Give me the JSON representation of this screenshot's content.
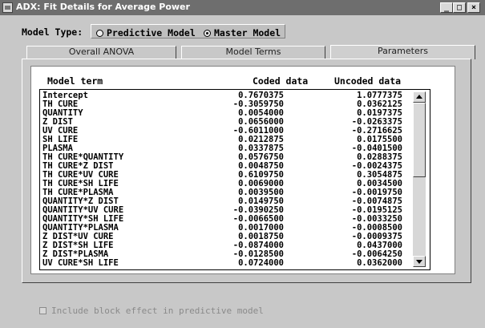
{
  "window": {
    "title": "ADX: Fit Details for Average Power",
    "buttons": {
      "minimize": "_",
      "maximize": "□",
      "close": "×"
    }
  },
  "model_type": {
    "label": "Model Type:",
    "options": [
      {
        "label": "Predictive Model",
        "selected": false
      },
      {
        "label": "Master Model",
        "selected": true
      }
    ]
  },
  "tabs": [
    {
      "label": "Overall ANOVA",
      "active": false
    },
    {
      "label": "Model Terms",
      "active": false
    },
    {
      "label": "Parameters",
      "active": true
    }
  ],
  "table": {
    "headers": [
      "Model term",
      "Coded data",
      "Uncoded data"
    ],
    "rows": [
      [
        "Intercept",
        "0.7670375",
        "1.0777375"
      ],
      [
        "TH CURE",
        "-0.3059750",
        "0.0362125"
      ],
      [
        "QUANTITY",
        "0.0054000",
        "0.0197375"
      ],
      [
        "Z DIST",
        "0.0656000",
        "-0.0263375"
      ],
      [
        "UV CURE",
        "-0.6011000",
        "-0.2716625"
      ],
      [
        "SH LIFE",
        "0.0212875",
        "0.0175500"
      ],
      [
        "PLASMA",
        "0.0337875",
        "-0.0401500"
      ],
      [
        "TH CURE*QUANTITY",
        "0.0576750",
        "0.0288375"
      ],
      [
        "TH CURE*Z DIST",
        "0.0048750",
        "-0.0024375"
      ],
      [
        "TH CURE*UV CURE",
        "0.6109750",
        "0.3054875"
      ],
      [
        "TH CURE*SH LIFE",
        "0.0069000",
        "0.0034500"
      ],
      [
        "TH CURE*PLASMA",
        "0.0039500",
        "-0.0019750"
      ],
      [
        "QUANTITY*Z DIST",
        "0.0149750",
        "-0.0074875"
      ],
      [
        "QUANTITY*UV CURE",
        "-0.0390250",
        "-0.0195125"
      ],
      [
        "QUANTITY*SH LIFE",
        "-0.0066500",
        "-0.0033250"
      ],
      [
        "QUANTITY*PLASMA",
        "0.0017000",
        "-0.0008500"
      ],
      [
        "Z DIST*UV CURE",
        "0.0018750",
        "-0.0009375"
      ],
      [
        "Z DIST*SH LIFE",
        "-0.0874000",
        "0.0437000"
      ],
      [
        "Z DIST*PLASMA",
        "-0.0128500",
        "-0.0064250"
      ],
      [
        "UV CURE*SH LIFE",
        "0.0724000",
        "0.0362000"
      ]
    ]
  },
  "block_effect": {
    "label": "Include block effect in predictive model",
    "checked": false,
    "enabled": false
  }
}
